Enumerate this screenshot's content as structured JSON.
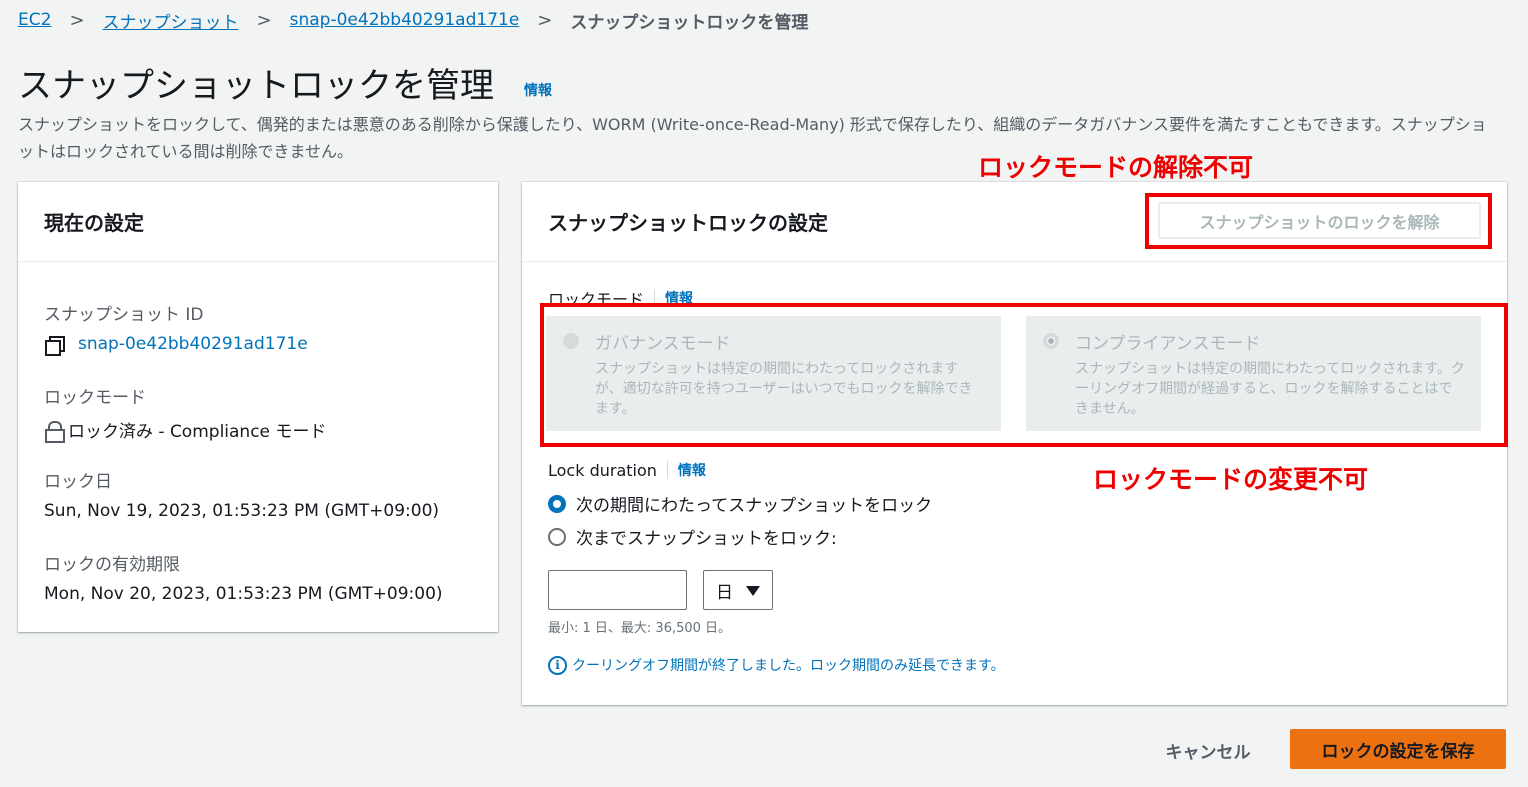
{
  "breadcrumb": {
    "items": [
      "EC2",
      "スナップショット",
      "snap-0e42bb40291ad171e"
    ],
    "current": "スナップショットロックを管理"
  },
  "page": {
    "title": "スナップショットロックを管理",
    "info": "情報",
    "description": "スナップショットをロックして、偶発的または悪意のある削除から保護したり、WORM (Write-once-Read-Many) 形式で保存したり、組織のデータガバナンス要件を満たすこともできます。スナップショットはロックされている間は削除できません。"
  },
  "current_settings": {
    "title": "現在の設定",
    "snapshot_id_label": "スナップショット ID",
    "snapshot_id": "snap-0e42bb40291ad171e",
    "lock_mode_label": "ロックモード",
    "lock_mode": "ロック済み - Compliance モード",
    "lock_date_label": "ロック日",
    "lock_date": "Sun, Nov 19, 2023, 01:53:23 PM (GMT+09:00)",
    "expiry_label": "ロックの有効期限",
    "expiry": "Mon, Nov 20, 2023, 01:53:23 PM (GMT+09:00)"
  },
  "lock_settings": {
    "title": "スナップショットロックの設定",
    "unlock_button": "スナップショットのロックを解除",
    "lock_mode_label": "ロックモード",
    "info": "情報",
    "modes": [
      {
        "title": "ガバナンスモード",
        "description": "スナップショットは特定の期間にわたってロックされますが、適切な許可を持つユーザーはいつでもロックを解除できます。",
        "selected": false
      },
      {
        "title": "コンプライアンスモード",
        "description": "スナップショットは特定の期間にわたってロックされます。クーリングオフ期間が経過すると、ロックを解除することはできません。",
        "selected": true
      }
    ],
    "duration_label": "Lock duration",
    "duration_options": [
      {
        "label": "次の期間にわたってスナップショットをロック",
        "selected": true
      },
      {
        "label": "次までスナップショットをロック:",
        "selected": false
      }
    ],
    "duration_value": "",
    "unit": "日",
    "constraint": "最小: 1 日、最大: 36,500 日。",
    "info_message": "クーリングオフ期間が終了しました。ロック期間のみ延長できます。",
    "info_icon": "i"
  },
  "actions": {
    "cancel": "キャンセル",
    "save": "ロックの設定を保存"
  },
  "annotations": {
    "unlock_disabled": "ロックモードの解除不可",
    "mode_locked": "ロックモードの変更不可",
    "color": "#ee0000"
  }
}
